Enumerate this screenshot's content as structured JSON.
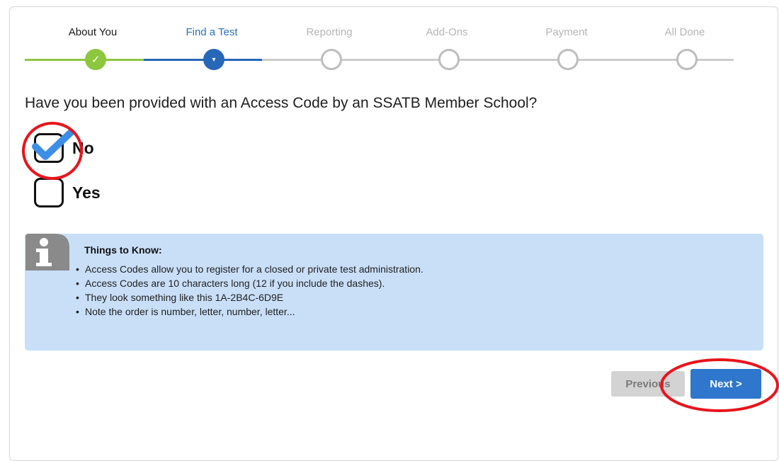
{
  "steps": [
    {
      "label": "About You",
      "state": "done"
    },
    {
      "label": "Find a Test",
      "state": "active"
    },
    {
      "label": "Reporting",
      "state": "pending"
    },
    {
      "label": "Add-Ons",
      "state": "pending"
    },
    {
      "label": "Payment",
      "state": "pending"
    },
    {
      "label": "All Done",
      "state": "pending"
    }
  ],
  "step_icons": {
    "done": "✓",
    "active": "▾"
  },
  "question": "Have you been provided with an Access Code by an SSATB Member School?",
  "options": [
    {
      "label": "No",
      "checked": true
    },
    {
      "label": "Yes",
      "checked": false
    }
  ],
  "info": {
    "icon": "info-icon",
    "title": "Things to Know:",
    "bullet": "•",
    "items": [
      "Access Codes allow you to register for a closed or private test administration.",
      "Access Codes are 10 characters long (12 if you include the dashes).",
      "They look something like this 1A-2B4C-6D9E",
      "Note the order is number, letter, number, letter..."
    ]
  },
  "buttons": {
    "previous": "Previous",
    "next": "Next >"
  },
  "colors": {
    "done": "#8dc63f",
    "active": "#2667b8",
    "pending": "#bdbdbd",
    "info_bg": "#c9dff8",
    "next_bg": "#2e77cc",
    "annotation": "#e8141c"
  }
}
